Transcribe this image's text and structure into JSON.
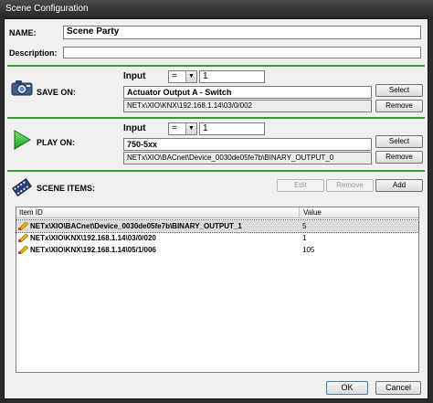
{
  "window": {
    "title": "Scene Configuration"
  },
  "name": {
    "label": "NAME:",
    "value": "Scene Party"
  },
  "description": {
    "label": "Description:",
    "value": ""
  },
  "save_on": {
    "label": "SAVE ON:",
    "input_label": "Input",
    "operator": "=",
    "input_value": "1",
    "target_name": "Actuator Output A - Switch",
    "target_path": "NETx\\XIO\\KNX\\192.168.1.14\\03/0/002",
    "select_label": "Select",
    "remove_label": "Remove",
    "icon": "camera-icon"
  },
  "play_on": {
    "label": "PLAY ON:",
    "input_label": "Input",
    "operator": "=",
    "input_value": "1",
    "target_name": "750-5xx",
    "target_path": "NETx\\XIO\\BACnet\\Device_0030de05fe7b\\BINARY_OUTPUT_0",
    "select_label": "Select",
    "remove_label": "Remove",
    "icon": "play-icon",
    "accent": "#2db52d"
  },
  "scene_items": {
    "label": "SCENE ITEMS:",
    "edit_label": "Edit",
    "remove_label": "Remove",
    "add_label": "Add",
    "icon": "film-icon",
    "columns": [
      "Item ID",
      "Value"
    ],
    "rows": [
      {
        "id": "NETx\\XIO\\BACnet\\Device_0030de05fe7b\\BINARY_OUTPUT_1",
        "value": "5"
      },
      {
        "id": "NETx\\XIO\\KNX\\192.168.1.14\\03/0/020",
        "value": "1"
      },
      {
        "id": "NETx\\XIO\\KNX\\192.168.1.14\\05/1/006",
        "value": "105"
      }
    ]
  },
  "footer": {
    "ok_label": "OK",
    "cancel_label": "Cancel"
  },
  "colors": {
    "separator": "#3a9a3a",
    "window_frame": "#2b2b2b"
  }
}
